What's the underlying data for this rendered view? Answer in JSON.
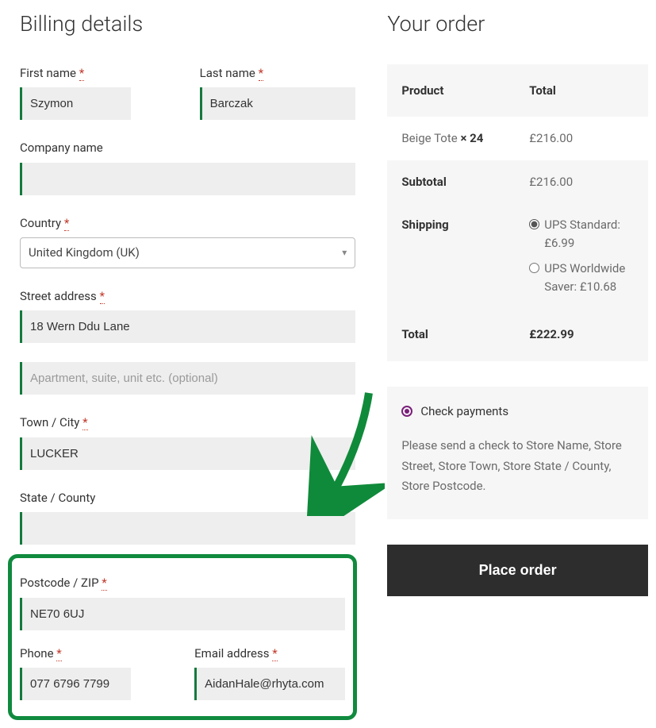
{
  "billing": {
    "title": "Billing details",
    "first_name_label": "First name",
    "first_name_value": "Szymon",
    "last_name_label": "Last name",
    "last_name_value": "Barczak",
    "company_label": "Company name",
    "company_value": "",
    "country_label": "Country",
    "country_value": "United Kingdom (UK)",
    "street_label": "Street address",
    "street1_value": "18 Wern Ddu Lane",
    "street2_placeholder": "Apartment, suite, unit etc. (optional)",
    "street2_value": "",
    "city_label": "Town / City",
    "city_value": "LUCKER",
    "state_label": "State / County",
    "state_value": "",
    "postcode_label": "Postcode / ZIP",
    "postcode_value": "NE70 6UJ",
    "phone_label": "Phone",
    "phone_value": "077 6796 7799",
    "email_label": "Email address",
    "email_value": "AidanHale@rhyta.com",
    "required_mark": "*"
  },
  "order": {
    "title": "Your order",
    "col_product": "Product",
    "col_total": "Total",
    "item_name": "Beige Tote ",
    "item_qty": "× 24",
    "item_total": "£216.00",
    "subtotal_label": "Subtotal",
    "subtotal_value": "£216.00",
    "shipping_label": "Shipping",
    "ship1_label": "UPS Standard: £6.99",
    "ship2_label": "UPS Worldwide Saver: £10.68",
    "total_label": "Total",
    "total_value": "£222.99",
    "payment_method": "Check payments",
    "payment_desc": "Please send a check to Store Name, Store Street, Store Town, Store State / County, Store Postcode.",
    "place_order": "Place order"
  }
}
